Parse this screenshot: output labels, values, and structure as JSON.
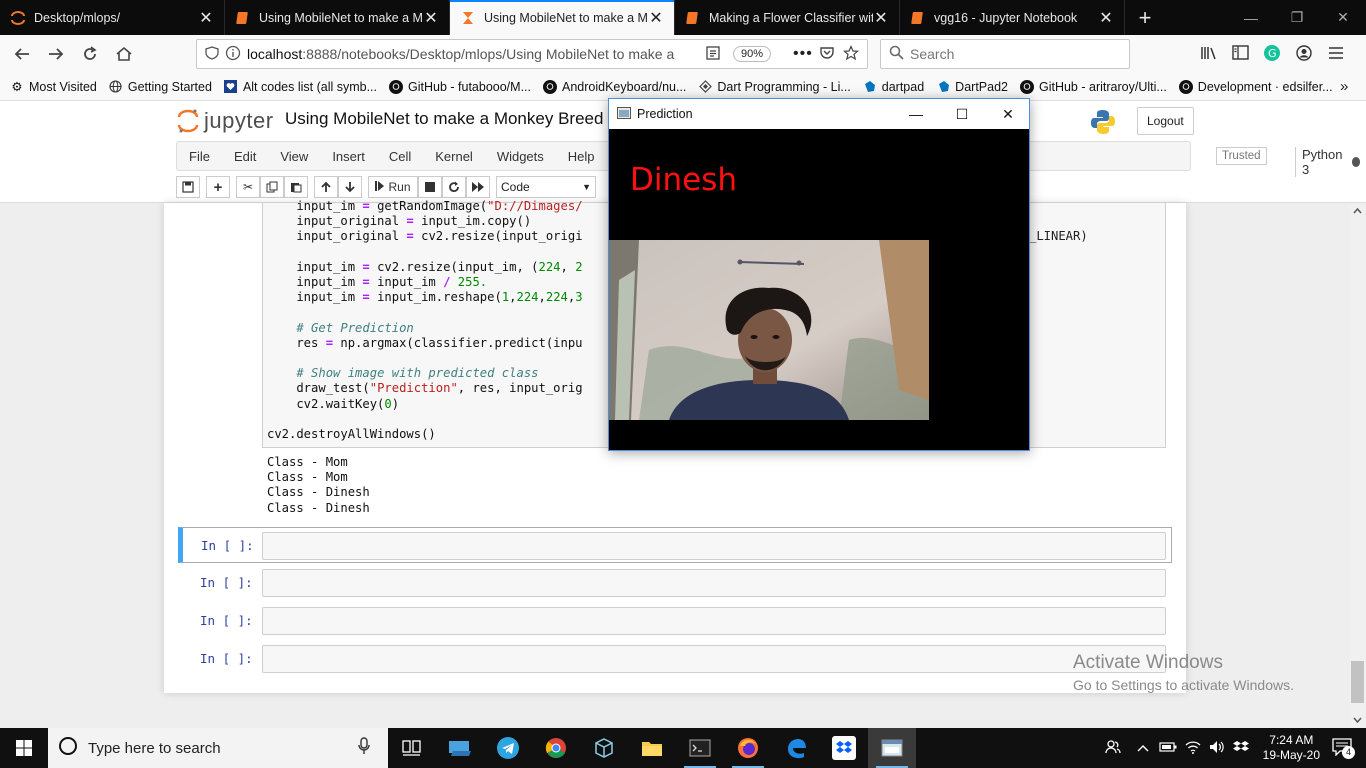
{
  "browser": {
    "tabs": [
      {
        "title": "Desktop/mlops/",
        "active": false
      },
      {
        "title": "Using MobileNet to make a Mo",
        "active": false
      },
      {
        "title": "Using MobileNet to make a Mo",
        "active": true
      },
      {
        "title": "Making a Flower Classifier with",
        "active": false
      },
      {
        "title": "vgg16 - Jupyter Notebook",
        "active": false
      }
    ],
    "url_host": "localhost",
    "url_rest": ":8888/notebooks/Desktop/mlops/Using MobileNet to make a",
    "zoom": "90%",
    "search_placeholder": "Search",
    "bookmarks": [
      "Most Visited",
      "Getting Started",
      "Alt codes list (all symb...",
      "GitHub - futabooo/M...",
      "AndroidKeyboard/nu...",
      "Dart Programming - Li...",
      "dartpad",
      "DartPad2",
      "GitHub - aritraroy/Ulti...",
      "Development · edsilfer..."
    ]
  },
  "jupyter": {
    "logo": "jupyter",
    "notebook_name": "Using MobileNet to make a Monkey Breed",
    "logout": "Logout",
    "menu": [
      "File",
      "Edit",
      "View",
      "Insert",
      "Cell",
      "Kernel",
      "Widgets",
      "Help"
    ],
    "trusted": "Trusted",
    "kernel": "Python 3",
    "run_label": "Run",
    "cell_type": "Code"
  },
  "code_lines": [
    "    input_im = getRandomImage(\"D://Dimages/",
    "    input_original = input_im.copy()",
    "    input_original = cv2.resize(input_origi",
    "",
    "    input_im = cv2.resize(input_im, (224, 2",
    "    input_im = input_im / 255.",
    "    input_im = input_im.reshape(1,224,224,3",
    "",
    "    # Get Prediction",
    "    res = np.argmax(classifier.predict(inpu",
    "",
    "    # Show image with predicted class",
    "    draw_test(\"Prediction\", res, input_orig",
    "    cv2.waitKey(0)",
    "",
    "cv2.destroyAllWindows()"
  ],
  "code_right_fragment": "_LINEAR)",
  "output_lines": [
    "Class - Mom",
    "Class - Mom",
    "Class - Dinesh",
    "Class - Dinesh"
  ],
  "empty_cells": [
    {
      "prompt": "In [ ]:",
      "selected": true
    },
    {
      "prompt": "In [ ]:",
      "selected": false
    },
    {
      "prompt": "In [ ]:",
      "selected": false
    },
    {
      "prompt": "In [ ]:",
      "selected": false
    }
  ],
  "prediction_window": {
    "title": "Prediction",
    "label": "Dinesh",
    "label_color": "#ff1010"
  },
  "activate_windows": {
    "title": "Activate Windows",
    "subtitle": "Go to Settings to activate Windows."
  },
  "taskbar": {
    "search_placeholder": "Type here to search",
    "time": "7:24 AM",
    "date": "19-May-20",
    "notifications": "4"
  }
}
